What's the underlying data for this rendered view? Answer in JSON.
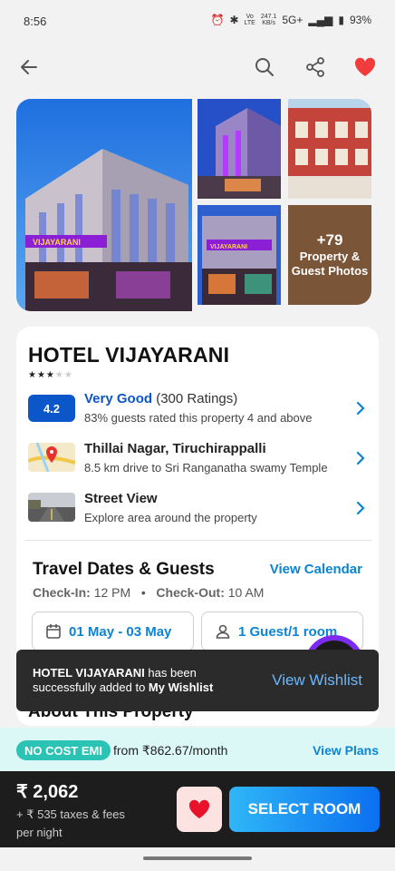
{
  "status_bar": {
    "time": "8:56",
    "network_speed_top": "247.1",
    "network_speed_unit": "KB/s",
    "signal": "5G+",
    "battery": "93%"
  },
  "top_bar": {
    "icons": [
      "back-arrow-icon",
      "search-icon",
      "share-icon",
      "heart-icon"
    ],
    "wishlisted": true,
    "accent": "#f23b3b"
  },
  "gallery": {
    "more_count": "+79",
    "more_label_line1": "Property &",
    "more_label_line2": "Guest Photos"
  },
  "hotel": {
    "name": "HOTEL VIJAYARANI",
    "stars_filled": 3,
    "stars_total": 5,
    "rating": {
      "score": "4.2",
      "label": "Very Good",
      "count": "(300 Ratings)",
      "sub": "83% guests rated this property 4 and above"
    },
    "location": {
      "title": "Thillai Nagar, Tiruchirappalli",
      "sub": "8.5 km drive to Sri Ranganatha swamy Temple"
    },
    "street_view": {
      "title": "Street View",
      "sub": "Explore area around the property"
    }
  },
  "travel": {
    "title": "Travel Dates & Guests",
    "view_calendar": "View Calendar",
    "checkin_label": "Check-In:",
    "checkin_time": "12 PM",
    "checkout_label": "Check-Out:",
    "checkout_time": "10 AM",
    "dates": "01 May - 03 May",
    "guests": "1 Guest/1 room"
  },
  "about": {
    "title": "About This Property"
  },
  "toast": {
    "hotel": "HOTEL VIJAYARANI",
    "mid": " has been successfully added to ",
    "target": "My Wishlist",
    "action": "View Wishlist"
  },
  "emi": {
    "tag": "NO COST EMI",
    "from": "from ₹862.67/month",
    "plans": "View Plans"
  },
  "booking": {
    "price": "₹ 2,062",
    "taxes": "+ ₹ 535 taxes & fees",
    "per_night": "per night",
    "select_room": "SELECT ROOM",
    "brand_color": "#0b84d6"
  }
}
